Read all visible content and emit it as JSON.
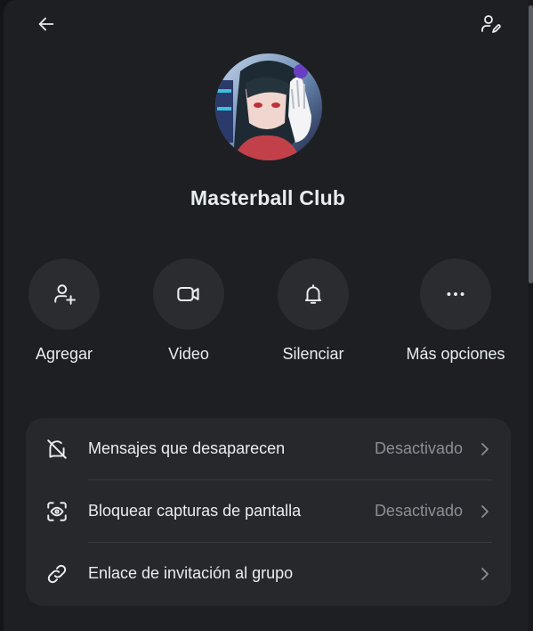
{
  "group": {
    "name": "Masterball Club"
  },
  "icons": {
    "back": "arrow-left-icon",
    "edit_members": "person-edit-icon"
  },
  "actions": [
    {
      "label": "Agregar",
      "icon": "person-add-icon"
    },
    {
      "label": "Video",
      "icon": "video-camera-icon"
    },
    {
      "label": "Silenciar",
      "icon": "bell-icon"
    },
    {
      "label": "Más opciones",
      "icon": "more-horizontal-icon"
    }
  ],
  "settings": [
    {
      "label": "Mensajes que desaparecen",
      "value": "Desactivado",
      "icon": "disappearing-messages-icon"
    },
    {
      "label": "Bloquear capturas de pantalla",
      "value": "Desactivado",
      "icon": "screenshot-block-icon"
    },
    {
      "label": "Enlace de invitación al grupo",
      "value": "",
      "icon": "link-icon"
    }
  ],
  "colors": {
    "background": "#1d1f22",
    "card": "#26282c",
    "button_circle": "#2a2c30",
    "text": "#e9edef",
    "muted": "#8b8f94"
  }
}
